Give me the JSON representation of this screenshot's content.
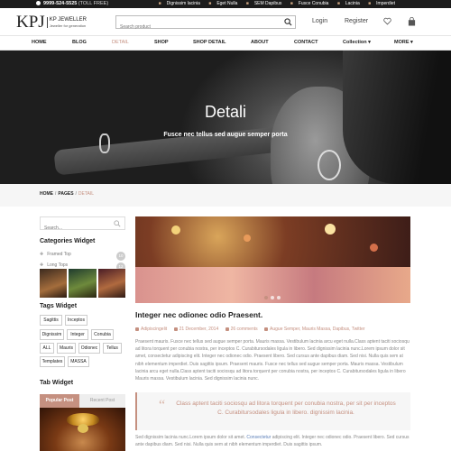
{
  "topbar": {
    "phone": "9999-524-5525",
    "toll": "(TOLL FREE)",
    "links": [
      "Dignissim lacinia",
      "Eget Nulla",
      "SEM Dapibus",
      "Fusce Conubia",
      "Lacinia",
      "Imperdiet"
    ]
  },
  "header": {
    "logo_main": "KPJ",
    "logo_line1": "KP JEWELLER",
    "logo_line2": "Jeweller for generation",
    "search_placeholder": "Search product",
    "login": "Login",
    "register": "Register"
  },
  "nav": {
    "items": [
      "HOME",
      "BLOG",
      "DETAIL",
      "SHOP",
      "SHOP DETAIL",
      "ABOUT",
      "CONTACT",
      "Collection ▾",
      "MORE ▾"
    ],
    "active": "DETAIL"
  },
  "hero": {
    "title": "Detali",
    "subtitle": "Fusce nec tellus sed augue semper porta"
  },
  "breadcrumb": {
    "home": "HOME",
    "pages": "PAGES",
    "current": "DETAIL",
    "sep": "/"
  },
  "sidebar": {
    "search_placeholder": "Search...",
    "categories_title": "Categories Widget",
    "categories": [
      {
        "label": "Framed Top",
        "count": "10"
      },
      {
        "label": "Long Tops",
        "count": "12"
      }
    ],
    "tags_title": "Tags Widget",
    "tags": [
      "Sagittis",
      "Inceptos",
      "Dignissim",
      "Integer",
      "Conubia",
      "ALL",
      "Mauris",
      "Odionec",
      "Tellus",
      "Templates",
      "MASSA"
    ],
    "tab_title": "Tab Widget",
    "tab_popular": "Popular Post",
    "tab_recent": "Recent Post"
  },
  "post": {
    "title": "Integer nec odionec odio Praesent.",
    "author": "Adipiscingelit",
    "date": "21 December, 2014",
    "comments": "26 comments",
    "categories": "Augue Semper, Mauris Massa, Dapibus, Twitter",
    "para1": "Praesent mauris. Fusce nec tellus sed augue semper porta. Mauris massa. Vestibulum lacinia arcu eget nulla.Class aptent taciti sociosqu ad litora torquent per conubia nostra, per inceptos C. Curabitursodales ligula in libero. Sed dignissim lacinia nunc.Lorem ipsum dolor sit amet, consectetur adipiscing elit. Integer nec odionec odio. Praesent libero. Sed cursus ante dapibus diam. Sed nisi. Nulla quis sem at nibh elementum imperdiet. Duis sagittis ipsum. Praesent mauris. Fusce nec tellus sed augue semper porta. Mauris massa. Vestibulum lacinia arcu eget nulla.Class aptent taciti sociosqu ad litora torquent per conubia nostra, per inceptos C. Curabitursodales ligula in libero Mauris massa. Vestibulum lacinia. Sed dignissim lacinia nunc.",
    "quote": "Class aptent taciti sociosqu ad litora torquent per conubia nostra, per sit per inceptos C. Curabitursodales ligula in libero. dignissim lacinia.",
    "para2_a": "Sed dignissim lacinia nunc.Lorem ipsum dolor sit amet.",
    "para2_link": "Consectetur",
    "para2_b": "adipiscing elit. Integer nec odionec odio. Praesent libero. Sed cursus ante dapibus diam. Sed nisi. Nulla quis sem at nibh elementum imperdiet. Duis sagittis ipsum."
  },
  "colors": {
    "accent": "#c59080",
    "topbar": "#1c1c1c"
  }
}
